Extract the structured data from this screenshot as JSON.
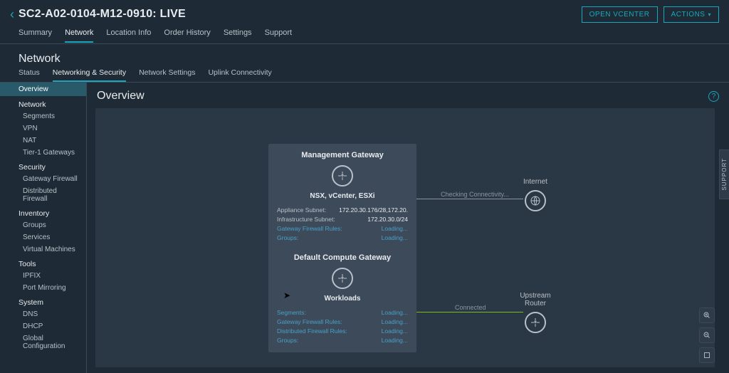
{
  "header": {
    "title": "SC2-A02-0104-M12-0910: LIVE",
    "open_vcenter": "OPEN VCENTER",
    "actions": "ACTIONS"
  },
  "tabs_primary": {
    "summary": "Summary",
    "network": "Network",
    "location": "Location Info",
    "order": "Order History",
    "settings": "Settings",
    "support": "Support"
  },
  "section_title": "Network",
  "tabs_secondary": {
    "status": "Status",
    "netsec": "Networking & Security",
    "netset": "Network Settings",
    "uplink": "Uplink Connectivity"
  },
  "sidebar": {
    "overview": "Overview",
    "g_network": "Network",
    "segments": "Segments",
    "vpn": "VPN",
    "nat": "NAT",
    "t1": "Tier-1 Gateways",
    "g_security": "Security",
    "gfw": "Gateway Firewall",
    "dfw": "Distributed Firewall",
    "g_inventory": "Inventory",
    "groups": "Groups",
    "services": "Services",
    "vms": "Virtual Machines",
    "g_tools": "Tools",
    "ipfix": "IPFIX",
    "mirror": "Port Mirroring",
    "g_system": "System",
    "dns": "DNS",
    "dhcp": "DHCP",
    "global": "Global Configuration"
  },
  "main": {
    "title": "Overview"
  },
  "mgmt": {
    "title": "Management Gateway",
    "subtitle": "NSX, vCenter, ESXi",
    "rows": {
      "appliance_k": "Appliance Subnet:",
      "appliance_v": "172.20.30.176/28,172.20.",
      "infra_k": "Infrastructure Subnet:",
      "infra_v": "172.20.30.0/24",
      "gfw_k": "Gateway Firewall Rules:",
      "gfw_v": "Loading...",
      "groups_k": "Groups:",
      "groups_v": "Loading..."
    }
  },
  "comp": {
    "title": "Default Compute Gateway",
    "subtitle": "Workloads",
    "rows": {
      "seg_k": "Segments:",
      "seg_v": "Loading...",
      "gfw_k": "Gateway Firewall Rules:",
      "gfw_v": "Loading...",
      "dfw_k": "Distributed Firewall Rules:",
      "dfw_v": "Loading...",
      "groups_k": "Groups:",
      "groups_v": "Loading..."
    }
  },
  "ext": {
    "internet": "Internet",
    "router": "Upstream Router"
  },
  "conn": {
    "checking": "Checking Connectivity...",
    "connected": "Connected"
  },
  "support_tab": "SUPPORT"
}
